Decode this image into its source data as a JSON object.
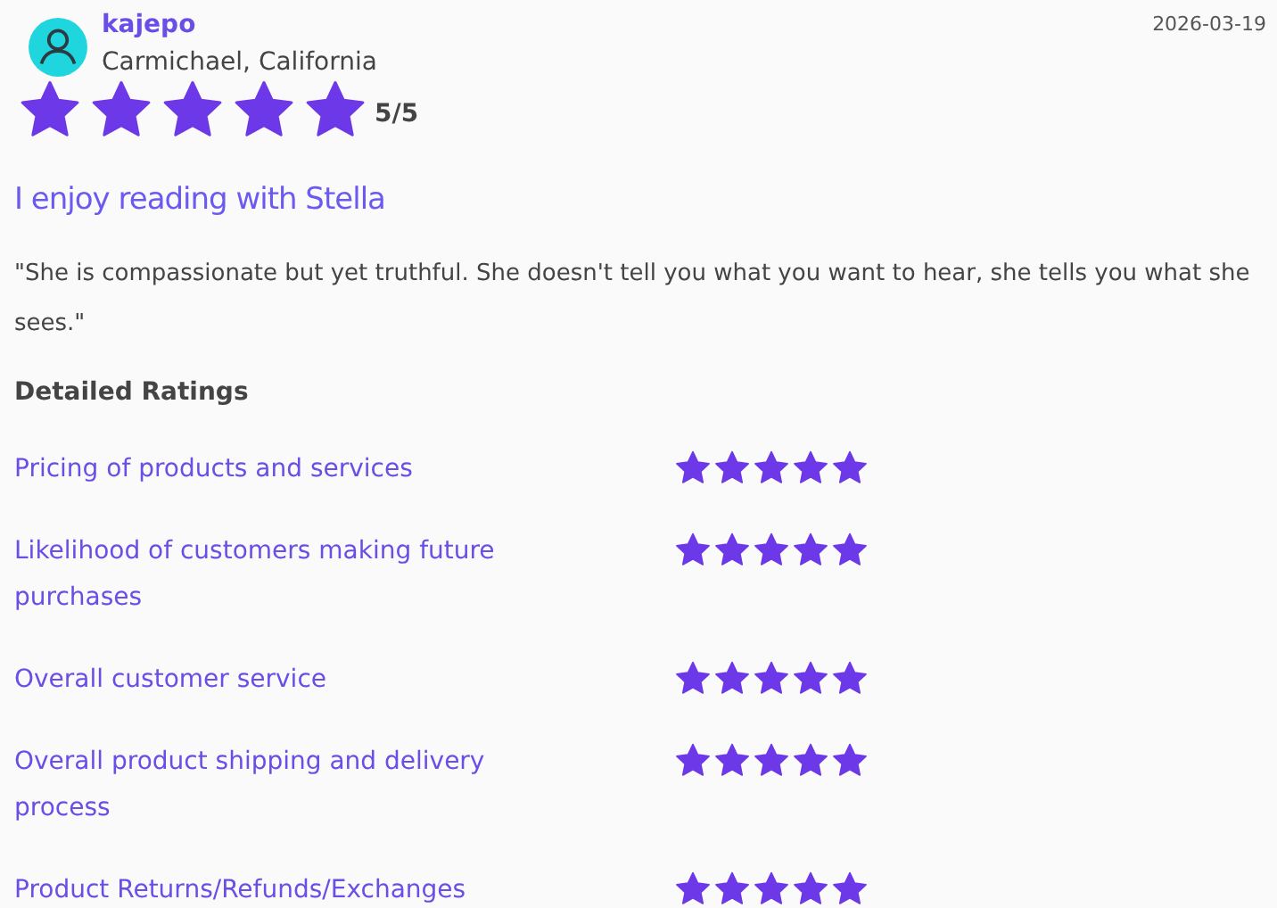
{
  "review": {
    "author": "kajepo",
    "location": "Carmichael, California",
    "date": "2026-03-19",
    "stars": 5,
    "score": "5/5",
    "title": "I enjoy reading with Stella",
    "text": "\"She is compassionate but yet truthful. She doesn't tell you what you want to hear, she tells you what she sees.\""
  },
  "detailed_ratings": {
    "heading": "Detailed Ratings",
    "items": [
      {
        "label": "Pricing of products and services",
        "stars": 5
      },
      {
        "label": "Likelihood of customers making future purchases",
        "stars": 5
      },
      {
        "label": "Overall customer service",
        "stars": 5
      },
      {
        "label": "Overall product shipping and delivery process",
        "stars": 5
      },
      {
        "label": "Product Returns/Refunds/Exchanges",
        "stars": 5
      }
    ]
  }
}
